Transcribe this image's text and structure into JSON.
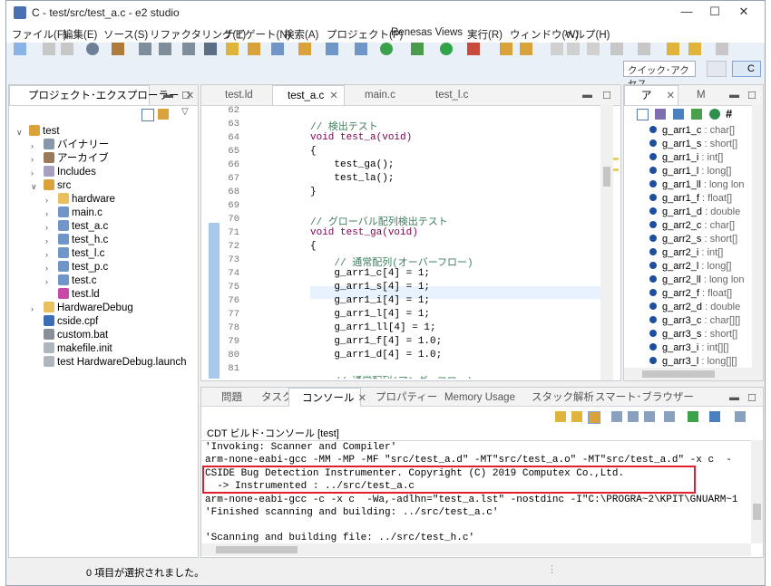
{
  "window": {
    "title": "C - test/src/test_a.c - e2 studio",
    "controls": [
      "—",
      "☐",
      "✕"
    ]
  },
  "menu": [
    "ファイル(F)",
    "編集(E)",
    "ソース(S)",
    "リファクタリング(T)",
    "ナビゲート(N)",
    "検索(A)",
    "プロジェクト(P)",
    "Renesas Views",
    "実行(R)",
    "ウィンドウ(W)",
    "ヘルプ(H)"
  ],
  "toolbar": {
    "quick_access": "クイック･アクセス",
    "perspective_label": "C"
  },
  "explorer": {
    "tab_label": "プロジェクト･エクスプローラー",
    "items": [
      {
        "label": "test"
      },
      {
        "label": "バイナリー"
      },
      {
        "label": "アーカイブ"
      },
      {
        "label": "Includes"
      },
      {
        "label": "src"
      },
      {
        "label": "hardware"
      },
      {
        "label": "main.c"
      },
      {
        "label": "test_a.c"
      },
      {
        "label": "test_h.c"
      },
      {
        "label": "test_l.c"
      },
      {
        "label": "test_p.c"
      },
      {
        "label": "test.c"
      },
      {
        "label": "test.ld"
      },
      {
        "label": "HardwareDebug"
      },
      {
        "label": "cside.cpf"
      },
      {
        "label": "custom.bat"
      },
      {
        "label": "makefile.init"
      },
      {
        "label": "test HardwareDebug.launch"
      }
    ]
  },
  "editor": {
    "tabs": [
      {
        "label": "test.ld"
      },
      {
        "label": "test_a.c"
      },
      {
        "label": "main.c"
      },
      {
        "label": "test_l.c"
      }
    ],
    "line_numbers": [
      "62",
      "63",
      "64",
      "65",
      "66",
      "67",
      "68",
      "69",
      "70",
      "71",
      "72",
      "73",
      "74",
      "75",
      "76",
      "77",
      "78",
      "79",
      "80",
      "81"
    ],
    "lines": [
      "",
      "// 検出テスト",
      "void test_a(void)",
      "{",
      "    test_ga();",
      "    test_la();",
      "}",
      "",
      "// グローバル配列検出テスト",
      "void test_ga(void)",
      "{",
      "    // 通常配列(オーバーフロー)",
      "    g_arr1_c[4] = 1;",
      "    g_arr1_s[4] = 1;",
      "    g_arr1_i[4] = 1;",
      "    g_arr1_l[4] = 1;",
      "    g_arr1_ll[4] = 1;",
      "    g_arr1_f[4] = 1.0;",
      "    g_arr1_d[4] = 1.0;",
      ""
    ],
    "partial_line": "    // 通常配列(アンダーフロー)"
  },
  "outline": {
    "tabs": [
      {
        "label": "ア"
      },
      {
        "label": "M"
      }
    ],
    "items": [
      {
        "name": "g_arr1_c",
        "type": " : char[]"
      },
      {
        "name": "g_arr1_s",
        "type": " : short[]"
      },
      {
        "name": "g_arr1_i",
        "type": " : int[]"
      },
      {
        "name": "g_arr1_l",
        "type": " : long[]"
      },
      {
        "name": "g_arr1_ll",
        "type": " : long lon"
      },
      {
        "name": "g_arr1_f",
        "type": " : float[]"
      },
      {
        "name": "g_arr1_d",
        "type": " : double"
      },
      {
        "name": "g_arr2_c",
        "type": " : char[]"
      },
      {
        "name": "g_arr2_s",
        "type": " : short[]"
      },
      {
        "name": "g_arr2_i",
        "type": " : int[]"
      },
      {
        "name": "g_arr2_l",
        "type": " : long[]"
      },
      {
        "name": "g_arr2_ll",
        "type": " : long lon"
      },
      {
        "name": "g_arr2_f",
        "type": " : float[]"
      },
      {
        "name": "g_arr2_d",
        "type": " : double"
      },
      {
        "name": "g_arr3_c",
        "type": " : char[][]"
      },
      {
        "name": "g_arr3_s",
        "type": " : short[]"
      },
      {
        "name": "g_arr3_i",
        "type": " : int[][]"
      },
      {
        "name": "g_arr3_l",
        "type": " : long[][]"
      }
    ]
  },
  "console": {
    "tabs": [
      {
        "label": "問題"
      },
      {
        "label": "タスク"
      },
      {
        "label": "コンソール"
      },
      {
        "label": "プロパティー"
      },
      {
        "label": "Memory Usage"
      },
      {
        "label": "スタック解析"
      },
      {
        "label": "スマート･ブラウザー"
      }
    ],
    "header": "CDT ビルド･コンソール [test]",
    "lines": [
      "'Invoking: Scanner and Compiler'",
      "arm-none-eabi-gcc -MM -MP -MF \"src/test_a.d\" -MT\"src/test_a.o\" -MT\"src/test_a.d\" -x c  -",
      "CSIDE Bug Detection Instrumenter. Copyright (C) 2019 Computex Co.,Ltd.",
      "  -> Instrumented : ../src/test_a.c",
      "arm-none-eabi-gcc -c -x c  -Wa,-adlhn=\"test_a.lst\" -nostdinc -I\"C:\\PROGRA~2\\KPIT\\GNUARM~1",
      "'Finished scanning and building: ../src/test_a.c'",
      "",
      "'Scanning and building file: ../src/test_h.c'"
    ],
    "highlight_color": "#e0202e"
  },
  "status": {
    "text": "0 項目が選択されました。"
  }
}
